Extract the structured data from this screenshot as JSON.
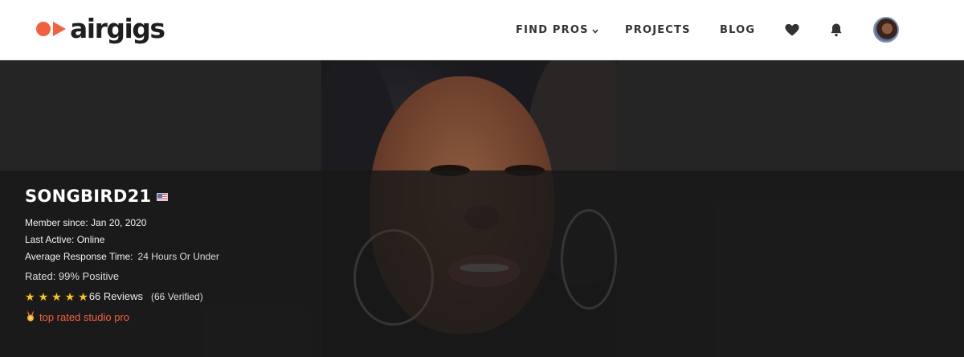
{
  "header": {
    "logo_text": "airgigs",
    "nav": [
      {
        "label": "FIND PROS",
        "has_dropdown": true
      },
      {
        "label": "PROJECTS"
      },
      {
        "label": "BLOG"
      }
    ],
    "icons": [
      "heart-icon",
      "bell-icon",
      "user-avatar"
    ]
  },
  "colors": {
    "brand": "#f0623f",
    "header_bg": "#ffffff",
    "hero_bg": "#252525",
    "star": "#f5c518"
  },
  "profile": {
    "username": "SONGBIRD21",
    "country_flag": "us-flag-icon",
    "member_since": "Member since: Jan 20, 2020",
    "last_active": "Last Active: Online",
    "response_label": "Average Response Time:",
    "response_value": "24 Hours Or Under",
    "rated": "Rated: 99% Positive",
    "stars": 5,
    "reviews": "66 Reviews",
    "verified": "(66 Verified)",
    "badge": "top rated studio pro",
    "badge_icon": "medal-icon"
  }
}
